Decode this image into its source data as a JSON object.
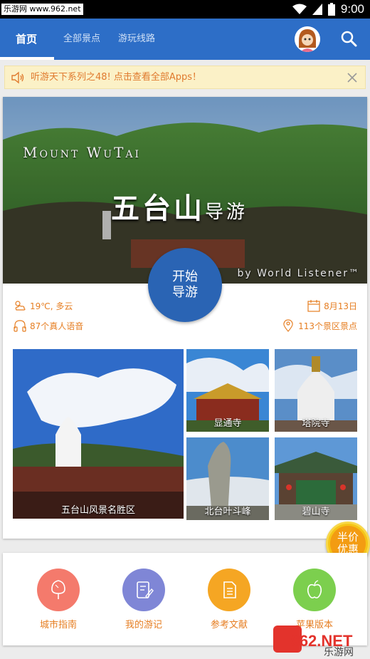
{
  "status_bar": {
    "watermark": "乐游网 www.962.net",
    "time": "9:00"
  },
  "header": {
    "tabs": [
      {
        "label": "首页",
        "active": true
      },
      {
        "label": "全部景点",
        "active": false
      },
      {
        "label": "游玩线路",
        "active": false
      }
    ]
  },
  "notice": {
    "text": "听游天下系列之48! 点击查看全部Apps！"
  },
  "hero": {
    "title_en": "Mount WuTai",
    "title_cn": "五台山",
    "title_cn_suffix": "导游",
    "byline": "by World Listener™",
    "start_button_line1": "开始",
    "start_button_line2": "导游"
  },
  "info": {
    "weather": "19℃, 多云",
    "date": "8月13日",
    "audio_count": "87个真人语音",
    "spot_count": "113个景区景点"
  },
  "attractions": [
    {
      "label": "五台山风景名胜区"
    },
    {
      "label": "显通寺"
    },
    {
      "label": "塔院寺"
    },
    {
      "label": "北台叶斗峰"
    },
    {
      "label": "碧山寺"
    }
  ],
  "promo_badge": {
    "line1": "半价",
    "line2": "优惠"
  },
  "features": [
    {
      "label": "城市指南",
      "color": "#f47a6c"
    },
    {
      "label": "我的游记",
      "color": "#7f86d6"
    },
    {
      "label": "参考文献",
      "color": "#f5a623"
    },
    {
      "label": "苹果版本",
      "color": "#7ccf4e"
    }
  ],
  "bottom_watermark": {
    "brand": "962.NET",
    "sub": "乐游网"
  },
  "colors": {
    "primary": "#2d6ec7",
    "accent_orange": "#e67e22",
    "notice_bg": "#fbf1c7"
  }
}
